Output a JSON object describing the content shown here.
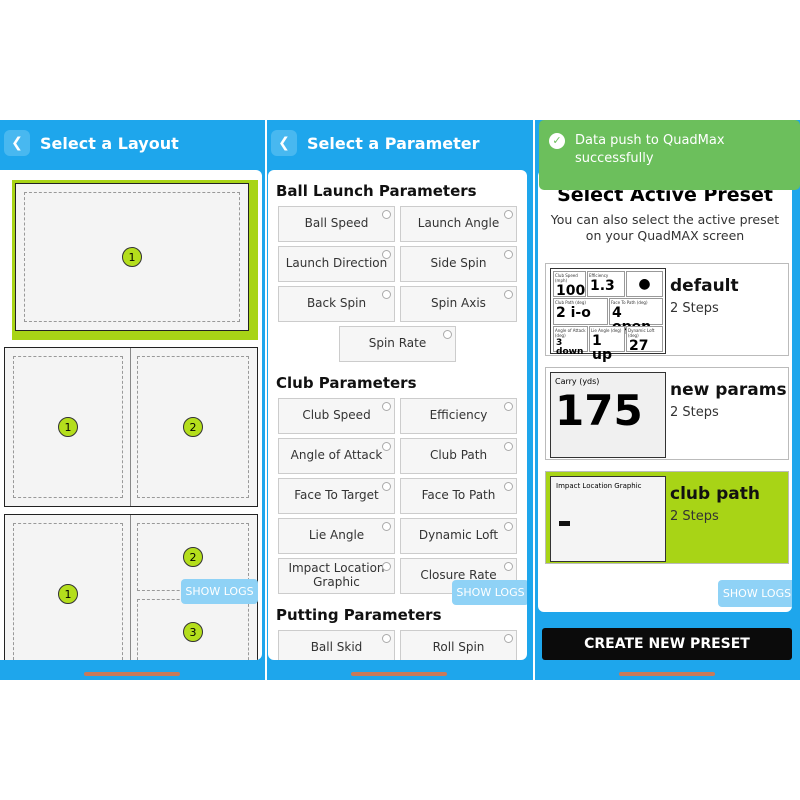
{
  "colors": {
    "header_blue": "#1ea6ec",
    "accent_green": "#a8d416",
    "toast_green": "#6cbf5c"
  },
  "panel1": {
    "title": "Select a Layout",
    "back_icon": "chevron-left-icon",
    "show_logs": "SHOW LOGS",
    "layouts": [
      {
        "zones": [
          "1"
        ]
      },
      {
        "zones": [
          "1",
          "2"
        ]
      },
      {
        "zones": [
          "1",
          "2",
          "3"
        ]
      }
    ]
  },
  "panel2": {
    "title": "Select a Parameter",
    "show_logs": "SHOW LOGS",
    "sections": [
      {
        "title": "Ball Launch Parameters",
        "items": [
          "Ball Speed",
          "Launch Angle",
          "Launch Direction",
          "Side Spin",
          "Back Spin",
          "Spin Axis",
          "Spin Rate"
        ]
      },
      {
        "title": "Club Parameters",
        "items": [
          "Club Speed",
          "Efficiency",
          "Angle of Attack",
          "Club Path",
          "Face To Target",
          "Face To Path",
          "Lie Angle",
          "Dynamic Loft",
          "Impact Location Graphic",
          "Closure Rate"
        ]
      },
      {
        "title": "Putting Parameters",
        "items": [
          "Ball Skid",
          "Roll Spin"
        ]
      }
    ]
  },
  "panel3": {
    "toast": "Data push to QuadMax successfully",
    "title": "Select Active Preset",
    "subtitle": "You can also select the active preset on your QuadMAX screen",
    "show_logs": "SHOW LOGS",
    "create_button": "CREATE NEW PRESET",
    "presets": [
      {
        "name": "default",
        "steps": "2 Steps",
        "selected": false,
        "cells": [
          {
            "label": "Club Speed (mph)",
            "value": "100"
          },
          {
            "label": "Efficiency",
            "value": "1.3"
          },
          {
            "label": "Club Path (deg)",
            "value": "2 i-o"
          },
          {
            "label": "Face To Path (deg)",
            "value": "4 open"
          },
          {
            "label": "Angle of Attack (deg)",
            "value": "3 down"
          },
          {
            "label": "Lie Angle (deg)",
            "value": "1 up"
          },
          {
            "label": "Dynamic Loft (deg)",
            "value": "27"
          }
        ]
      },
      {
        "name": "new params",
        "steps": "2 Steps",
        "selected": false,
        "cells": [
          {
            "label": "Carry (yds)",
            "value": "175"
          }
        ]
      },
      {
        "name": "club path",
        "steps": "2 Steps",
        "selected": true,
        "cells": [
          {
            "label": "Impact Location Graphic",
            "value": ""
          }
        ]
      }
    ]
  }
}
